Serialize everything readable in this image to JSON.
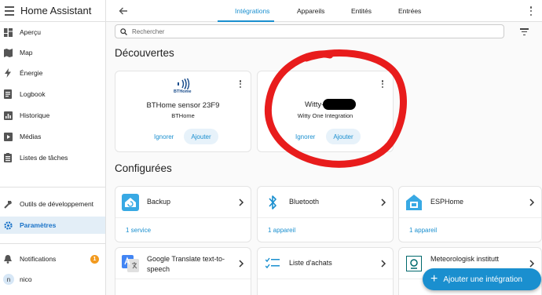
{
  "app": {
    "title": "Home Assistant"
  },
  "sidebar": {
    "items": [
      {
        "label": "Aperçu",
        "icon": "dashboard-icon"
      },
      {
        "label": "Map",
        "icon": "map-icon"
      },
      {
        "label": "Énergie",
        "icon": "lightning-icon"
      },
      {
        "label": "Logbook",
        "icon": "logbook-icon"
      },
      {
        "label": "Historique",
        "icon": "history-chart-icon"
      },
      {
        "label": "Médias",
        "icon": "media-icon"
      },
      {
        "label": "Listes de tâches",
        "icon": "clipboard-list-icon"
      }
    ],
    "dev_tools": "Outils de développement",
    "settings": "Paramètres",
    "notifications": "Notifications",
    "notifications_count": "1",
    "user_initial": "n",
    "user_name": "nico"
  },
  "topbar": {
    "tabs": [
      "Intégrations",
      "Appareils",
      "Entités",
      "Entrées"
    ],
    "active_tab": "Intégrations"
  },
  "search": {
    "placeholder": "Rechercher"
  },
  "discovered": {
    "title": "Découvertes",
    "cards": [
      {
        "logo_text": "BTHome",
        "name": "BTHome sensor 23F9",
        "subtitle": "BTHome",
        "ignore": "Ignorer",
        "add": "Ajouter"
      },
      {
        "name": "Witty-",
        "subtitle": "Witty One Integration",
        "ignore": "Ignorer",
        "add": "Ajouter"
      }
    ]
  },
  "configured": {
    "title": "Configurées",
    "cards": [
      {
        "name": "Backup",
        "link": "1 service",
        "icon": "backup-home-icon"
      },
      {
        "name": "Bluetooth",
        "link": "1 appareil",
        "icon": "bluetooth-icon"
      },
      {
        "name": "ESPHome",
        "link": "1 appareil",
        "icon": "esphome-icon"
      },
      {
        "name": "Google Translate text-to-speech",
        "icon": "google-translate-icon"
      },
      {
        "name": "Liste d'achats",
        "icon": "shopping-list-icon"
      },
      {
        "name": "Meteorologisk institutt",
        "icon": "met-icon"
      }
    ]
  },
  "fab": {
    "label": "Ajouter une intégration"
  },
  "colors": {
    "accent": "#1a8fcf",
    "annotation": "#e81c1c",
    "badge": "#f29a1f"
  }
}
